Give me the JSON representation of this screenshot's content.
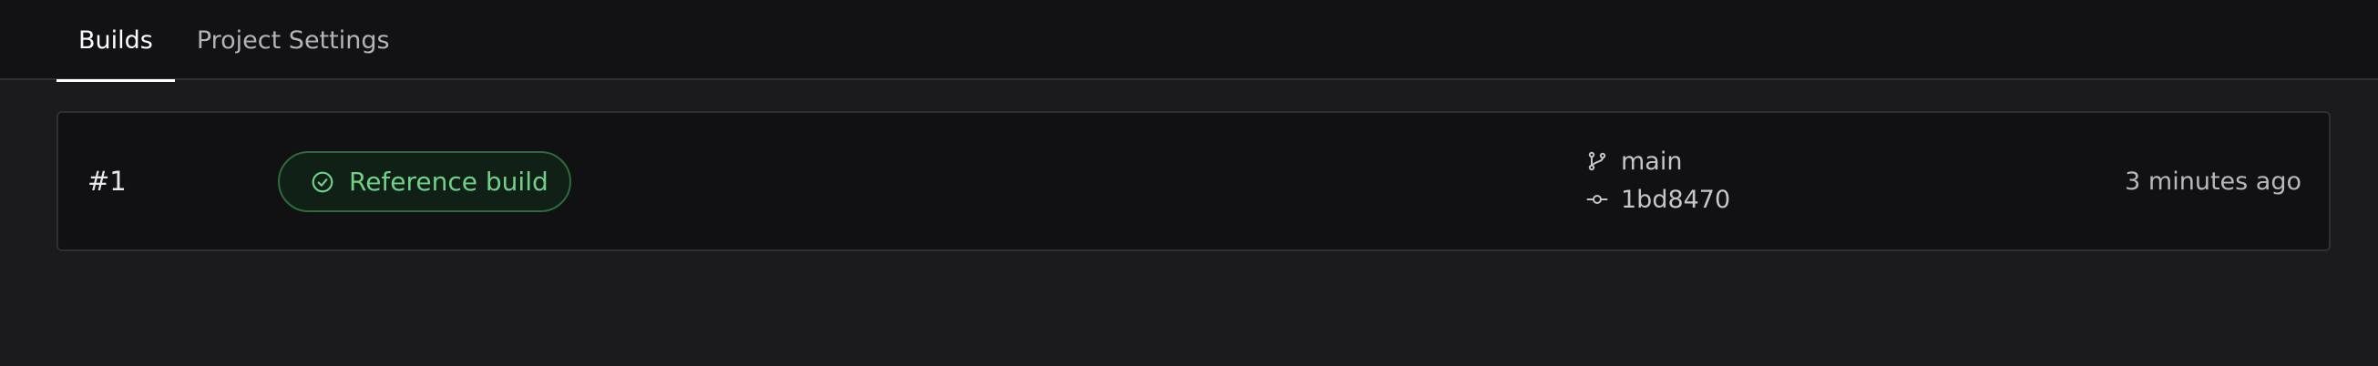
{
  "tabs": {
    "builds_label": "Builds",
    "settings_label": "Project Settings"
  },
  "build": {
    "number": "#1",
    "status_label": "Reference build",
    "branch": "main",
    "commit": "1bd8470",
    "time": "3 minutes ago"
  },
  "icons": {
    "status": "check-circle-icon",
    "branch": "git-branch-icon",
    "commit": "git-commit-icon"
  },
  "colors": {
    "active_tab": "#ffffff",
    "status_green": "#6fd188",
    "status_border": "#2e6a3a"
  }
}
